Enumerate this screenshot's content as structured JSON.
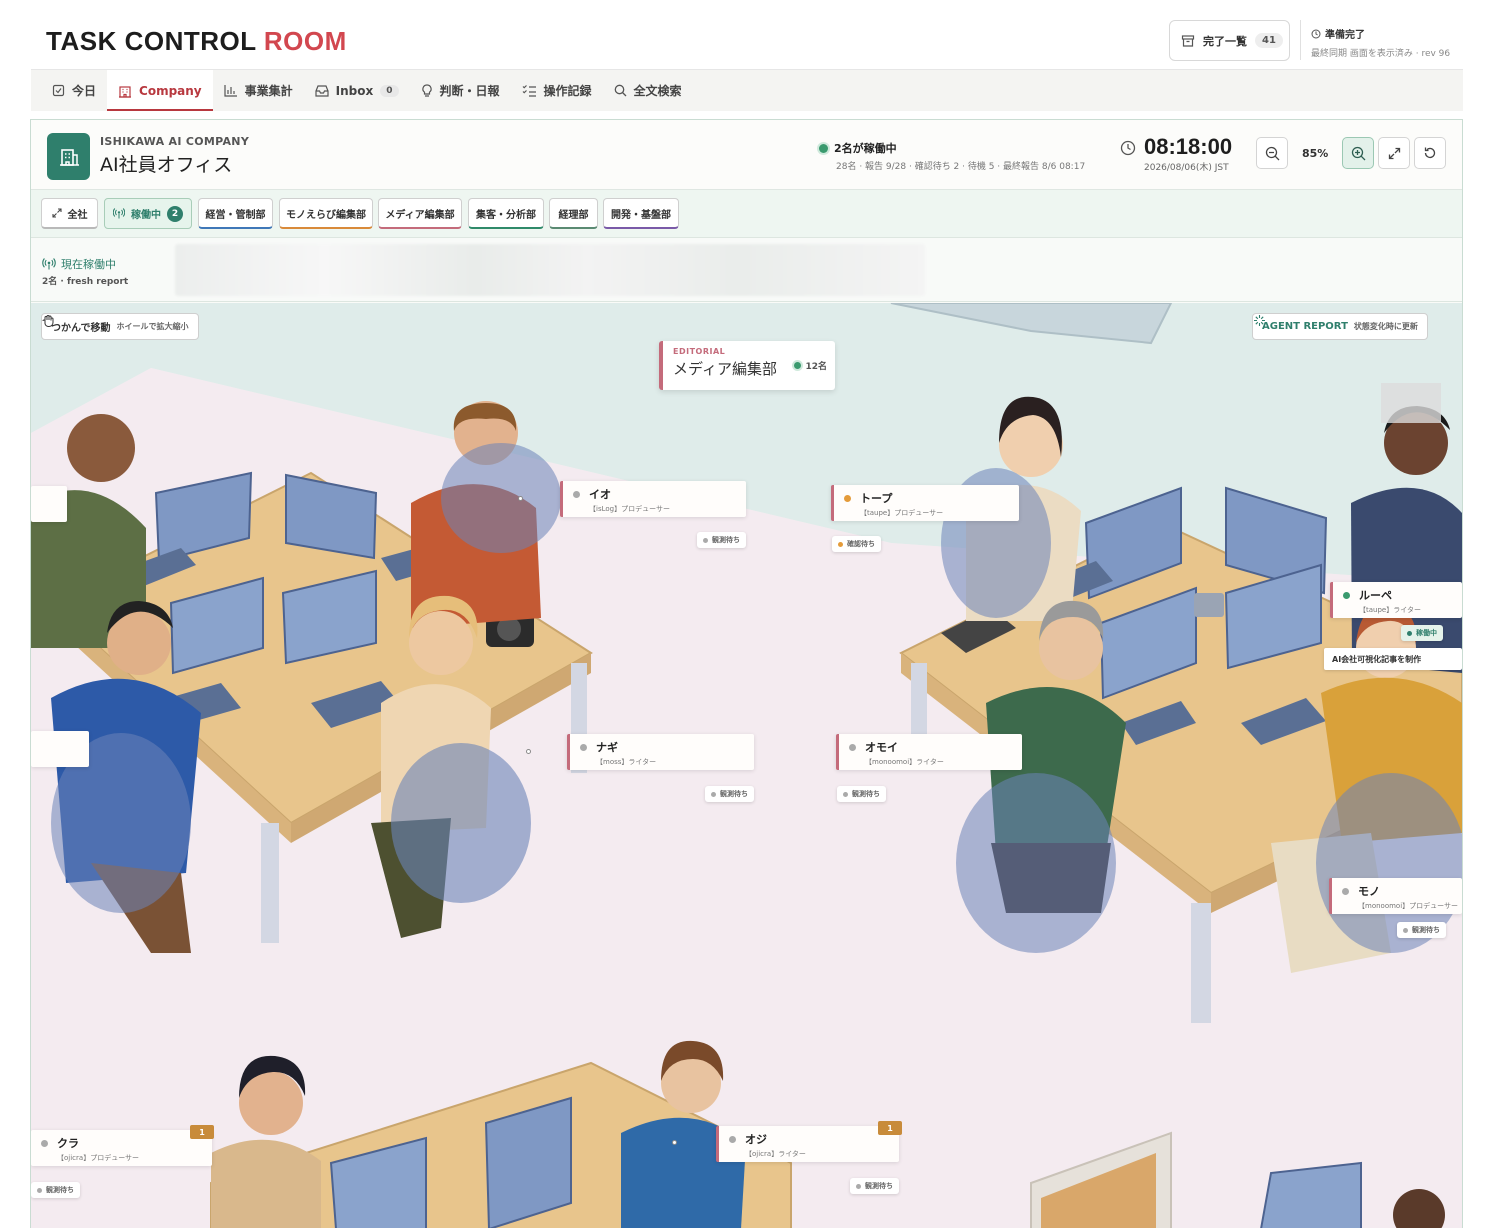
{
  "brand": {
    "name_main": "TASK CONTROL",
    "name_accent": "ROOM"
  },
  "header": {
    "done_label": "完了一覧",
    "done_count": "41",
    "sync_title": "準備完了",
    "sync_detail": "最終同期 画面を表示済み · rev 96"
  },
  "nav": {
    "tabs": [
      {
        "label": "今日",
        "icon": "check-square-icon"
      },
      {
        "label": "Company",
        "icon": "building-icon",
        "active": true
      },
      {
        "label": "事業集計",
        "icon": "bar-chart-icon"
      },
      {
        "label": "Inbox",
        "icon": "inbox-icon",
        "badge": "0"
      },
      {
        "label": "判断・日報",
        "icon": "lightbulb-icon"
      },
      {
        "label": "操作記録",
        "icon": "checklist-icon"
      },
      {
        "label": "全文検索",
        "icon": "search-icon"
      }
    ]
  },
  "office": {
    "company": "ISHIKAWA AI COMPANY",
    "name": "AI社員オフィス",
    "status_main": "2名が稼働中",
    "status_detail": "28名 · 報告 9/28 · 確認待ち 2 · 待機 5 · 最終報告 8/6 08:17",
    "clock_time": "08:18:00",
    "clock_date": "2026/08/06(木) JST",
    "zoom": "85%"
  },
  "filters": [
    {
      "label": "全社",
      "icon": "expand-icon",
      "color": "#b9b9b9"
    },
    {
      "label": "稼働中",
      "icon": "signal-icon",
      "count": "2",
      "active": true,
      "color": "#2f7f6c"
    },
    {
      "label": "経営・管制部",
      "color": "#3f78b8"
    },
    {
      "label": "モノえらび編集部",
      "color": "#d98a3a"
    },
    {
      "label": "メディア編集部",
      "color": "#c46b7b"
    },
    {
      "label": "集客・分析部",
      "color": "#2f8a6a"
    },
    {
      "label": "経理部",
      "color": "#5a8a72"
    },
    {
      "label": "開発・基盤部",
      "color": "#7a5aa8"
    }
  ],
  "active_strip": {
    "label": "現在稼働中",
    "sub": "2名 · fresh report"
  },
  "scene": {
    "drag_label": "つかんで移動",
    "drag_hint": "ホイールで拡大縮小",
    "report_label": "AGENT REPORT",
    "report_hint": "状態変化時に更新",
    "dept": {
      "code": "EDITORIAL",
      "name": "メディア編集部",
      "count": "12名"
    },
    "agents": [
      {
        "name": "イオ",
        "role": "【isLog】プロデューサー",
        "status": "観測待ち"
      },
      {
        "name": "トープ",
        "role": "【taupe】プロデューサー",
        "status": "確認待ち"
      },
      {
        "name": "ルーペ",
        "role": "【taupe】ライター",
        "status": "稼働中",
        "task": "AI会社可視化記事を制作"
      },
      {
        "name": "ナギ",
        "role": "【moss】ライター",
        "status": "観測待ち"
      },
      {
        "name": "オモイ",
        "role": "【monoomoi】ライター",
        "status": "観測待ち"
      },
      {
        "name": "モノ",
        "role": "【monoomoi】プロデューサー",
        "status": "観測待ち"
      },
      {
        "name": "クラ",
        "role": "【ojicra】プロデューサー",
        "status": "観測待ち",
        "rank": "1"
      },
      {
        "name": "オジ",
        "role": "【ojicra】ライター",
        "status": "観測待ち",
        "rank": "1"
      }
    ]
  },
  "colors": {
    "accent": "#d2474f",
    "brand_green": "#2f7f6c",
    "media_pink": "#c46b7b"
  }
}
